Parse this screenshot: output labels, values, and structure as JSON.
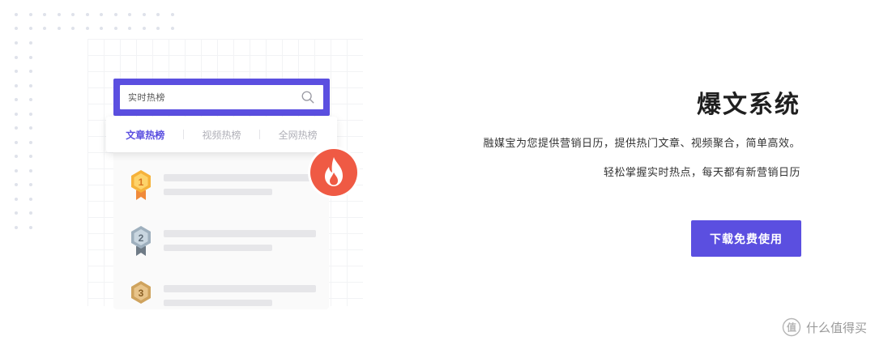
{
  "search": {
    "label": "实时热榜"
  },
  "tabs": [
    {
      "label": "文章热榜",
      "active": true
    },
    {
      "label": "视频热榜",
      "active": false
    },
    {
      "label": "全网热榜",
      "active": false
    }
  ],
  "ranks": [
    {
      "number": "1",
      "medal": "gold-medal-icon"
    },
    {
      "number": "2",
      "medal": "silver-medal-icon"
    },
    {
      "number": "3",
      "medal": "bronze-medal-icon"
    }
  ],
  "hero": {
    "title": "爆文系统",
    "description_line1": "融媒宝为您提供营销日历，提供热门文章、视频聚合，简单高效。",
    "description_line2": "轻松掌握实时热点，每天都有新营销日历"
  },
  "cta": {
    "label": "下载免费使用"
  },
  "watermark": {
    "text": "什么值得买"
  },
  "colors": {
    "accent": "#5b4fe0",
    "fire": "#ef5a44"
  }
}
